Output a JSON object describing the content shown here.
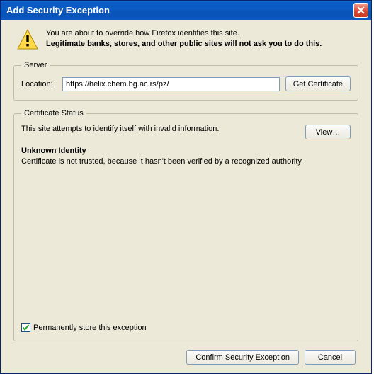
{
  "window": {
    "title": "Add Security Exception"
  },
  "intro": {
    "line1": "You are about to override how Firefox identifies this site.",
    "line2": "Legitimate banks, stores, and other public sites will not ask you to do this."
  },
  "server": {
    "legend": "Server",
    "location_label": "Location:",
    "location_value": "https://helix.chem.bg.ac.rs/pz/",
    "get_cert_label": "Get Certificate"
  },
  "cert_status": {
    "legend": "Certificate Status",
    "attempt_msg": "This site attempts to identify itself with invalid information.",
    "view_label": "View…",
    "unknown_heading": "Unknown Identity",
    "unknown_body": "Certificate is not trusted, because it hasn't been verified by a recognized authority.",
    "perm_label": "Permanently store this exception"
  },
  "footer": {
    "confirm_label": "Confirm Security Exception",
    "cancel_label": "Cancel"
  }
}
